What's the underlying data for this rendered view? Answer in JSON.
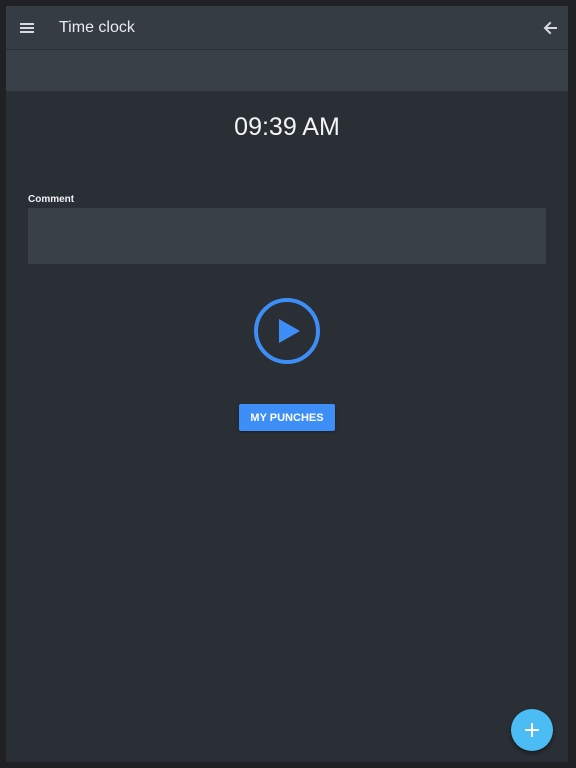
{
  "header": {
    "title": "Time clock",
    "menu_icon": "menu-icon",
    "back_icon": "arrow-back-icon"
  },
  "clock": {
    "time": "09:39 AM"
  },
  "comment": {
    "label": "Comment",
    "value": ""
  },
  "actions": {
    "punch_icon": "play-icon",
    "my_punches_label": "MY PUNCHES",
    "fab_icon": "plus-icon"
  },
  "colors": {
    "background": "#2a2e35",
    "toolbar": "#363c43",
    "accent": "#3d8ef7",
    "fab": "#4bbcf4"
  }
}
